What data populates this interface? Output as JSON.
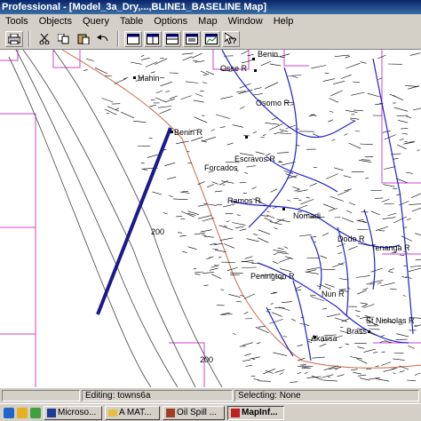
{
  "window": {
    "title": "Professional - [Model_3a_Dry,...,BLINE1_BASELINE Map]"
  },
  "menu": {
    "items": [
      "Tools",
      "Objects",
      "Query",
      "Table",
      "Options",
      "Map",
      "Window",
      "Help"
    ]
  },
  "toolbar": {
    "buttons": [
      "print-icon",
      "cut-icon",
      "copy-icon",
      "paste-icon",
      "undo-icon",
      "window-1-icon",
      "window-2-icon",
      "window-3-icon",
      "window-4-icon",
      "window-5-icon",
      "help-pointer-icon"
    ]
  },
  "map": {
    "place_labels": [
      "Benin",
      "Osse R",
      "Mahin",
      "Osomo R",
      "Benin R",
      "Escravos R",
      "Forcados",
      "Ramos R",
      "Nomadi",
      "Dodo R",
      "Penington R",
      "Akassa",
      "Brass",
      "St Nicholas R",
      "Nun R",
      "Tenanga R"
    ],
    "contour_labels": [
      "200",
      "200"
    ],
    "colors": {
      "baseline": "#1a1a8c",
      "rivers": "#2020cc",
      "boundary": "#cc44cc",
      "coastline": "#cc6644",
      "contours": "#555555"
    }
  },
  "status": {
    "editing_label": "Editing: towns6a",
    "selecting_label": "Selecting: None"
  },
  "taskbar": {
    "quick_launch": [
      "ie-icon",
      "outlook-icon",
      "desktop-icon"
    ],
    "tasks": [
      {
        "label": "Microso...",
        "icon": "word-icon"
      },
      {
        "label": "A MAT...",
        "icon": "folder-icon"
      },
      {
        "label": "Oil Spill ...",
        "icon": "app-icon"
      },
      {
        "label": "MapInf...",
        "icon": "mapinfo-icon"
      }
    ]
  }
}
